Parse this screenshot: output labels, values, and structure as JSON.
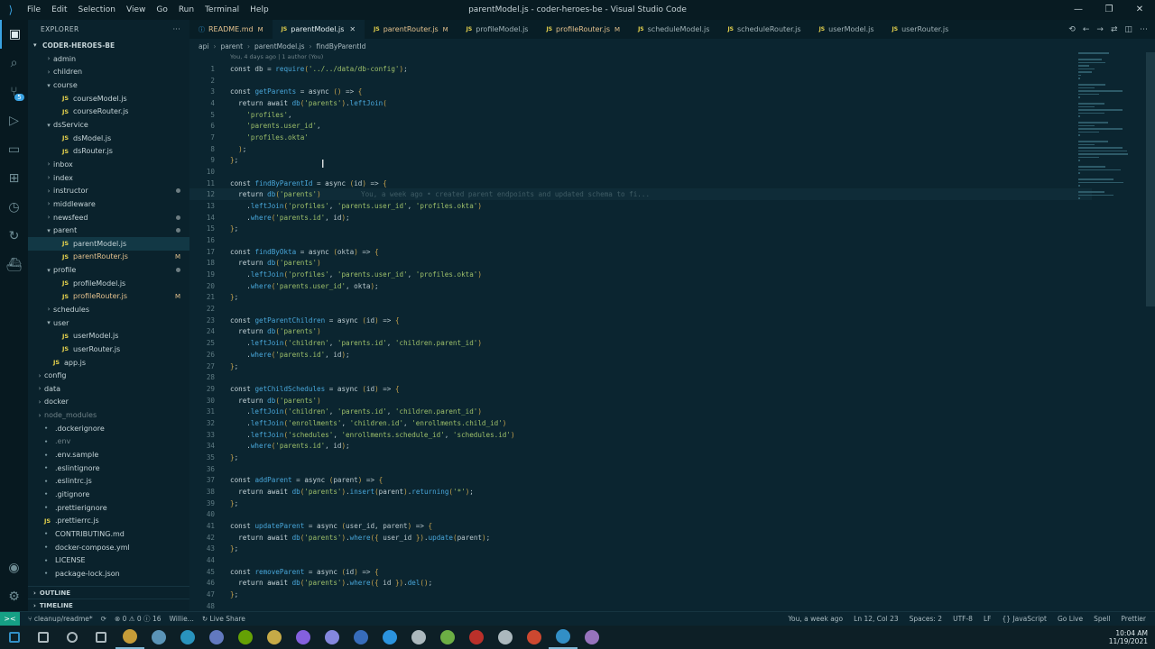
{
  "window": {
    "title": "parentModel.js - coder-heroes-be - Visual Studio Code",
    "menu": [
      "File",
      "Edit",
      "Selection",
      "View",
      "Go",
      "Run",
      "Terminal",
      "Help"
    ]
  },
  "activity_bar": {
    "items": [
      "explorer-icon",
      "search-icon",
      "source-control-icon",
      "run-debug-icon",
      "remote-explorer-icon",
      "extensions-icon",
      "timeline-icon",
      "live-share-icon",
      "docker-icon"
    ],
    "scm_badge": "5",
    "bottom": [
      "account-icon",
      "settings-gear-icon"
    ]
  },
  "sidebar": {
    "title": "EXPLORER",
    "more": "···",
    "root": "CODER-HEROES-BE",
    "tree": [
      {
        "label": "admin",
        "type": "folder",
        "depth": 1,
        "open": false
      },
      {
        "label": "children",
        "type": "folder",
        "depth": 1,
        "open": false
      },
      {
        "label": "course",
        "type": "folder",
        "depth": 1,
        "open": true
      },
      {
        "label": "courseModel.js",
        "type": "js",
        "depth": 2
      },
      {
        "label": "courseRouter.js",
        "type": "js",
        "depth": 2
      },
      {
        "label": "dsService",
        "type": "folder",
        "depth": 1,
        "open": true
      },
      {
        "label": "dsModel.js",
        "type": "js",
        "depth": 2
      },
      {
        "label": "dsRouter.js",
        "type": "js",
        "depth": 2
      },
      {
        "label": "inbox",
        "type": "folder",
        "depth": 1,
        "open": false
      },
      {
        "label": "index",
        "type": "folder",
        "depth": 1,
        "open": false
      },
      {
        "label": "instructor",
        "type": "folder",
        "depth": 1,
        "open": false,
        "dot": true
      },
      {
        "label": "middleware",
        "type": "folder",
        "depth": 1,
        "open": false
      },
      {
        "label": "newsfeed",
        "type": "folder",
        "depth": 1,
        "open": false,
        "dot": true
      },
      {
        "label": "parent",
        "type": "folder",
        "depth": 1,
        "open": true,
        "dot": true
      },
      {
        "label": "parentModel.js",
        "type": "js",
        "depth": 2,
        "selected": true
      },
      {
        "label": "parentRouter.js",
        "type": "js",
        "depth": 2,
        "status": "M"
      },
      {
        "label": "profile",
        "type": "folder",
        "depth": 1,
        "open": true,
        "dot": true
      },
      {
        "label": "profileModel.js",
        "type": "js",
        "depth": 2
      },
      {
        "label": "profileRouter.js",
        "type": "js",
        "depth": 2,
        "status": "M"
      },
      {
        "label": "schedules",
        "type": "folder",
        "depth": 1,
        "open": false
      },
      {
        "label": "user",
        "type": "folder",
        "depth": 1,
        "open": true
      },
      {
        "label": "userModel.js",
        "type": "js",
        "depth": 2
      },
      {
        "label": "userRouter.js",
        "type": "js",
        "depth": 2
      },
      {
        "label": "app.js",
        "type": "js",
        "depth": 1
      },
      {
        "label": "config",
        "type": "folder",
        "depth": 0,
        "open": false
      },
      {
        "label": "data",
        "type": "folder",
        "depth": 0,
        "open": false
      },
      {
        "label": "docker",
        "type": "folder",
        "depth": 0,
        "open": false
      },
      {
        "label": "node_modules",
        "type": "folder",
        "depth": 0,
        "open": false,
        "dim": true
      },
      {
        "label": ".dockerignore",
        "type": "file",
        "depth": 0
      },
      {
        "label": ".env",
        "type": "file",
        "depth": 0,
        "dim": true
      },
      {
        "label": ".env.sample",
        "type": "file",
        "depth": 0
      },
      {
        "label": ".eslintignore",
        "type": "file",
        "depth": 0
      },
      {
        "label": ".eslintrc.js",
        "type": "file",
        "depth": 0
      },
      {
        "label": ".gitignore",
        "type": "file",
        "depth": 0
      },
      {
        "label": ".prettierignore",
        "type": "file",
        "depth": 0
      },
      {
        "label": ".prettierrc.js",
        "type": "js",
        "depth": 0
      },
      {
        "label": "CONTRIBUTING.md",
        "type": "file",
        "depth": 0
      },
      {
        "label": "docker-compose.yml",
        "type": "file",
        "depth": 0
      },
      {
        "label": "LICENSE",
        "type": "file",
        "depth": 0
      },
      {
        "label": "package-lock.json",
        "type": "file",
        "depth": 0
      }
    ],
    "sections": [
      "OUTLINE",
      "TIMELINE"
    ]
  },
  "tabs": [
    {
      "label": "README.md",
      "kind": "md",
      "status": "M"
    },
    {
      "label": "parentModel.js",
      "kind": "js",
      "active": true
    },
    {
      "label": "parentRouter.js",
      "kind": "js",
      "status": "M"
    },
    {
      "label": "profileModel.js",
      "kind": "js"
    },
    {
      "label": "profileRouter.js",
      "kind": "js",
      "status": "M"
    },
    {
      "label": "scheduleModel.js",
      "kind": "js"
    },
    {
      "label": "scheduleRouter.js",
      "kind": "js"
    },
    {
      "label": "userModel.js",
      "kind": "js"
    },
    {
      "label": "userRouter.js",
      "kind": "js"
    }
  ],
  "breadcrumb": [
    "api",
    "parent",
    "parentModel.js",
    "findByParentId"
  ],
  "blame_header": "You, 4 days ago | 1 author (You)",
  "code": {
    "current_line": 12,
    "ghost_blame": "You, a week ago • created parent endpoints and updated schema to fi...",
    "lines": [
      "const db = require('../../data/db-config');",
      "",
      "const getParents = async () => {",
      "  return await db('parents').leftJoin(",
      "    'profiles',",
      "    'parents.user_id',",
      "    'profiles.okta'",
      "  );",
      "};",
      "",
      "const findByParentId = async (id) => {",
      "  return db('parents')",
      "    .leftJoin('profiles', 'parents.user_id', 'profiles.okta')",
      "    .where('parents.id', id);",
      "};",
      "",
      "const findByOkta = async (okta) => {",
      "  return db('parents')",
      "    .leftJoin('profiles', 'parents.user_id', 'profiles.okta')",
      "    .where('parents.user_id', okta);",
      "};",
      "",
      "const getParentChildren = async (id) => {",
      "  return db('parents')",
      "    .leftJoin('children', 'parents.id', 'children.parent_id')",
      "    .where('parents.id', id);",
      "};",
      "",
      "const getChildSchedules = async (id) => {",
      "  return db('parents')",
      "    .leftJoin('children', 'parents.id', 'children.parent_id')",
      "    .leftJoin('enrollments', 'children.id', 'enrollments.child_id')",
      "    .leftJoin('schedules', 'enrollments.schedule_id', 'schedules.id')",
      "    .where('parents.id', id);",
      "};",
      "",
      "const addParent = async (parent) => {",
      "  return await db('parents').insert(parent).returning('*');",
      "};",
      "",
      "const updateParent = async (user_id, parent) => {",
      "  return await db('parents').where({ user_id }).update(parent);",
      "};",
      "",
      "const removeParent = async (id) => {",
      "  return await db('parents').where({ id }).del();",
      "};",
      ""
    ]
  },
  "statusbar": {
    "remote": "><",
    "branch": "cleanup/readme*",
    "problems": "⊗ 0 ⚠ 0 ⓘ 16",
    "user": "Willie...",
    "liveshare": "Live Share",
    "right": [
      "You, a week ago",
      "Ln 12, Col 23",
      "Spaces: 2",
      "UTF-8",
      "LF",
      "{} JavaScript",
      "Go Live",
      "Spell",
      "Prettier"
    ]
  },
  "taskbar": {
    "apps": [
      {
        "name": "windows-start-icon",
        "color": "#3aa3e3"
      },
      {
        "name": "search-icon",
        "color": "#c8d4d8"
      },
      {
        "name": "cortana-icon",
        "color": "#c8d4d8"
      },
      {
        "name": "task-view-icon",
        "color": "#c8d4d8"
      },
      {
        "name": "chrome-icon",
        "color": "#e8b33c",
        "active": true
      },
      {
        "name": "steam-icon",
        "color": "#6aa9d1"
      },
      {
        "name": "edge-icon",
        "color": "#2fa8d8"
      },
      {
        "name": "discord-icon",
        "color": "#7289da"
      },
      {
        "name": "nvidia-icon",
        "color": "#76b900"
      },
      {
        "name": "file-explorer-icon",
        "color": "#e8c34d"
      },
      {
        "name": "premiere-icon",
        "color": "#9a6cff"
      },
      {
        "name": "after-effects-icon",
        "color": "#9a9aff"
      },
      {
        "name": "media-encoder-icon",
        "color": "#3f7ad6"
      },
      {
        "name": "photoshop-icon",
        "color": "#31a8ff"
      },
      {
        "name": "paint-icon",
        "color": "#c8d4d8"
      },
      {
        "name": "greenshot-icon",
        "color": "#7ec84a"
      },
      {
        "name": "youtube-studio-icon",
        "color": "#d9342b"
      },
      {
        "name": "sandbox-icon",
        "color": "#c8d4d8"
      },
      {
        "name": "git-icon",
        "color": "#f05033"
      },
      {
        "name": "vscode-icon",
        "color": "#3aa3e3",
        "active": true
      },
      {
        "name": "github-desktop-icon",
        "color": "#b082d8"
      }
    ],
    "time": "10:04 AM",
    "date": "11/19/2021"
  }
}
